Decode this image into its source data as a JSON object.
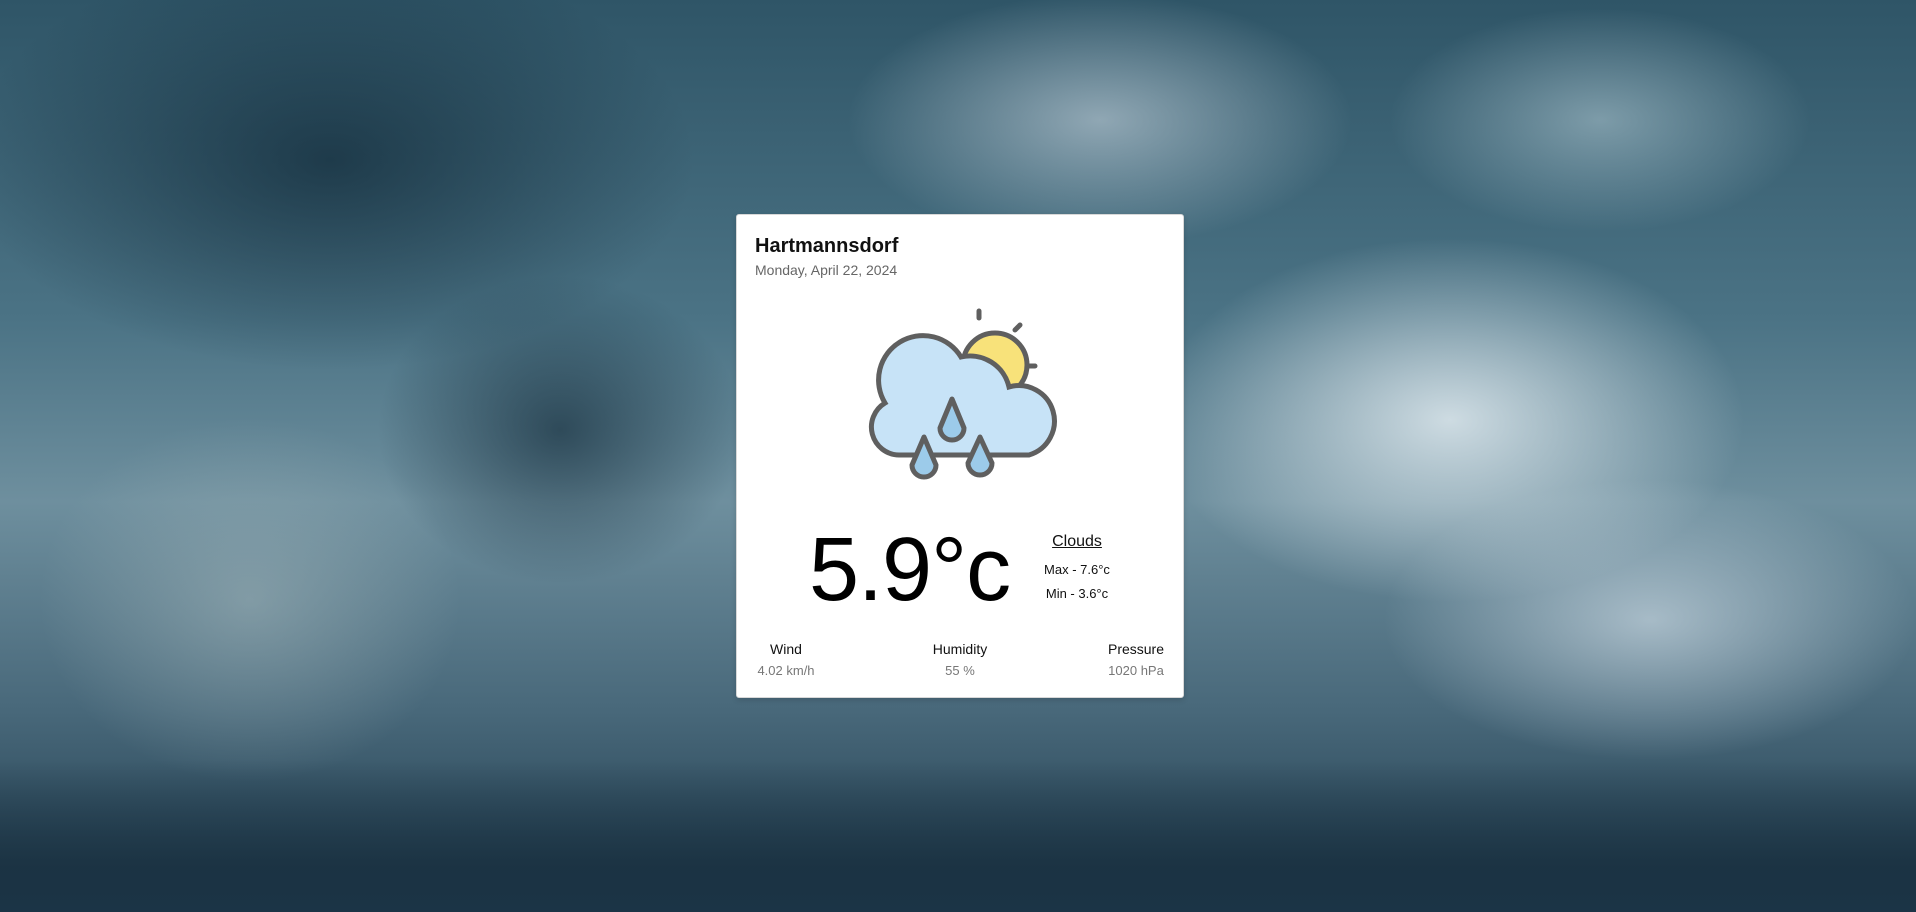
{
  "weather": {
    "city": "Hartmannsdorf",
    "date": "Monday, April 22, 2024",
    "icon": "cloud-sun-rain-icon",
    "temperature": "5.9°c",
    "condition": "Clouds",
    "max": "Max - 7.6°c",
    "min": "Min - 3.6°c"
  },
  "stats": {
    "wind_label": "Wind",
    "wind_value": "4.02 km/h",
    "humidity_label": "Humidity",
    "humidity_value": "55 %",
    "pressure_label": "Pressure",
    "pressure_value": "1020 hPa"
  },
  "colors": {
    "cloud_fill": "#c7e3f7",
    "sun_fill": "#f8e27a",
    "drop_fill": "#9ccbea",
    "outline": "#5f5f5f"
  }
}
